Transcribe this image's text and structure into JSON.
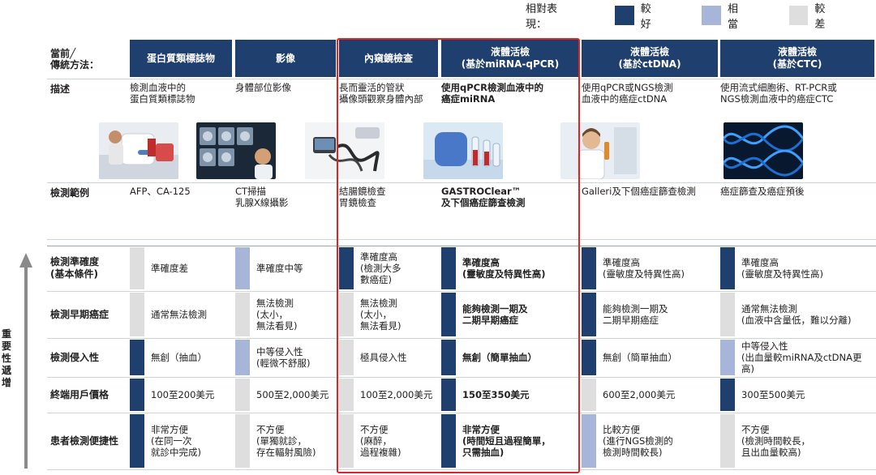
{
  "legend": {
    "title": "相對表現：",
    "items": [
      {
        "label": "較好",
        "color": "#1f3f6e"
      },
      {
        "label": "相當",
        "color": "#a7b6d8"
      },
      {
        "label": "較差",
        "color": "#dedede"
      }
    ]
  },
  "axis_label": "重要性遞增",
  "header_label": "當前╱\n傳統方法：",
  "columns": [
    {
      "title": "蛋白質類標誌物"
    },
    {
      "title": "影像"
    },
    {
      "title": "內窺鏡檢查"
    },
    {
      "title": "液體活檢\n(基於miRNA-qPCR)"
    },
    {
      "title": "液體活檢\n(基於ctDNA)"
    },
    {
      "title": "液體活檢\n(基於CTC)"
    }
  ],
  "rows": {
    "description": {
      "label": "描述",
      "cells": [
        "檢測血液中的\n蛋白質類標誌物",
        "身體部位影像",
        "長而靈活的管狀\n攝像頭觀察身體內部",
        "使用qPCR檢測血液中的\n癌症miRNA",
        "使用qPCR或NGS檢測\n血液中的癌症ctDNA",
        "使用流式細胞術、RT-PCR或\nNGS檢測血液中的癌症CTC"
      ]
    },
    "examples": {
      "label": "檢測範例",
      "cells": [
        "AFP、CA-125",
        "CT掃描\n乳腺X線攝影",
        "結腸鏡檢查\n胃鏡檢查",
        "GASTROClear™\n及下個癌症篩查檢測",
        "Galleri及下個癌症篩查檢測",
        "癌症篩查及癌症預後"
      ]
    },
    "accuracy": {
      "label": "檢測準確度\n(基本條件)",
      "cells": [
        {
          "text": "準確度差",
          "rating": "較差"
        },
        {
          "text": "準確度中等",
          "rating": "相當"
        },
        {
          "text": "準確度高\n(檢測大多\n數癌症)",
          "rating": "較好"
        },
        {
          "text": "準確度高\n(靈敏度及特異性高)",
          "rating": "較好"
        },
        {
          "text": "準確度高\n(靈敏度及特異性高)",
          "rating": "較好"
        },
        {
          "text": "準確度高\n(靈敏度及特異性高)",
          "rating": "較好"
        }
      ]
    },
    "early": {
      "label": "檢測早期癌症",
      "cells": [
        {
          "text": "通常無法檢測",
          "rating": "較差"
        },
        {
          "text": "無法檢測\n(太小，\n無法看見)",
          "rating": "較差"
        },
        {
          "text": "無法檢測\n(太小，\n無法看見)",
          "rating": "較差"
        },
        {
          "text": "能夠檢測一期及\n二期早期癌症",
          "rating": "較好"
        },
        {
          "text": "能夠檢測一期及\n二期早期癌症",
          "rating": "較好"
        },
        {
          "text": "通常無法檢測\n(血液中含量低，難以分離)",
          "rating": "較差"
        }
      ]
    },
    "invasive": {
      "label": "檢測侵入性",
      "cells": [
        {
          "text": "無創（抽血）",
          "rating": "較好"
        },
        {
          "text": "中等侵入性\n(輕微不舒服)",
          "rating": "相當"
        },
        {
          "text": "極具侵入性",
          "rating": "較差"
        },
        {
          "text": "無創（簡單抽血）",
          "rating": "較好"
        },
        {
          "text": "無創（簡單抽血）",
          "rating": "較好"
        },
        {
          "text": "中等侵入性\n(出血量較miRNA及ctDNA更高)",
          "rating": "相當"
        }
      ]
    },
    "price": {
      "label": "終端用戶價格",
      "cells": [
        {
          "text": "100至200美元",
          "rating": "較好"
        },
        {
          "text": "500至2,000美元",
          "rating": "較差"
        },
        {
          "text": "100至2,000美元",
          "rating": "較差"
        },
        {
          "text": "150至350美元",
          "rating": "較好"
        },
        {
          "text": "600至2,000美元",
          "rating": "較差"
        },
        {
          "text": "300至500美元",
          "rating": "較好"
        }
      ]
    },
    "convenience": {
      "label": "患者檢測便捷性",
      "cells": [
        {
          "text": "非常方便\n(在同一次\n就診中完成)",
          "rating": "較好"
        },
        {
          "text": "不方便\n(單獨就診，\n存在輻射風險)",
          "rating": "較差"
        },
        {
          "text": "不方便\n(麻醉，\n過程複雜)",
          "rating": "較差"
        },
        {
          "text": "非常方便\n(時間短且過程簡單，\n只需抽血)",
          "rating": "較好"
        },
        {
          "text": "比較方便\n(進行NGS檢測的\n檢測時間較長)",
          "rating": "相當"
        },
        {
          "text": "不方便\n(檢測時間較長，\n且出血量較高)",
          "rating": "較差"
        }
      ]
    }
  },
  "images": [
    "blood-draw-photo",
    "ct-scan-photo",
    "endoscope-photo",
    "qpcr-lab-photo",
    "scientist-photo",
    "dna-helix-photo"
  ]
}
